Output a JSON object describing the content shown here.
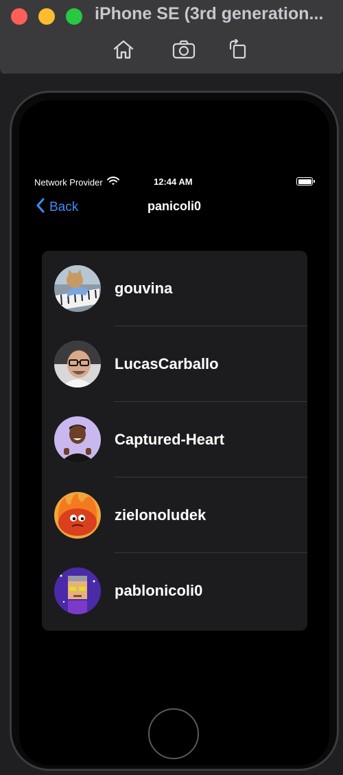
{
  "window": {
    "title": "iPhone SE (3rd generation..."
  },
  "toolbar": {
    "home_icon": "home-icon",
    "screenshot_icon": "camera-icon",
    "rotate_icon": "rotate-icon"
  },
  "status_bar": {
    "carrier": "Network Provider",
    "time": "12:44 AM"
  },
  "nav": {
    "back_label": "Back",
    "title": "panicoli0"
  },
  "users": [
    {
      "name": "gouvina"
    },
    {
      "name": "LucasCarballo"
    },
    {
      "name": "Captured-Heart"
    },
    {
      "name": "zielonoludek"
    },
    {
      "name": "pablonicoli0"
    }
  ],
  "colors": {
    "accent": "#3a8ff5",
    "background": "#000000",
    "card": "#1c1c1e"
  }
}
